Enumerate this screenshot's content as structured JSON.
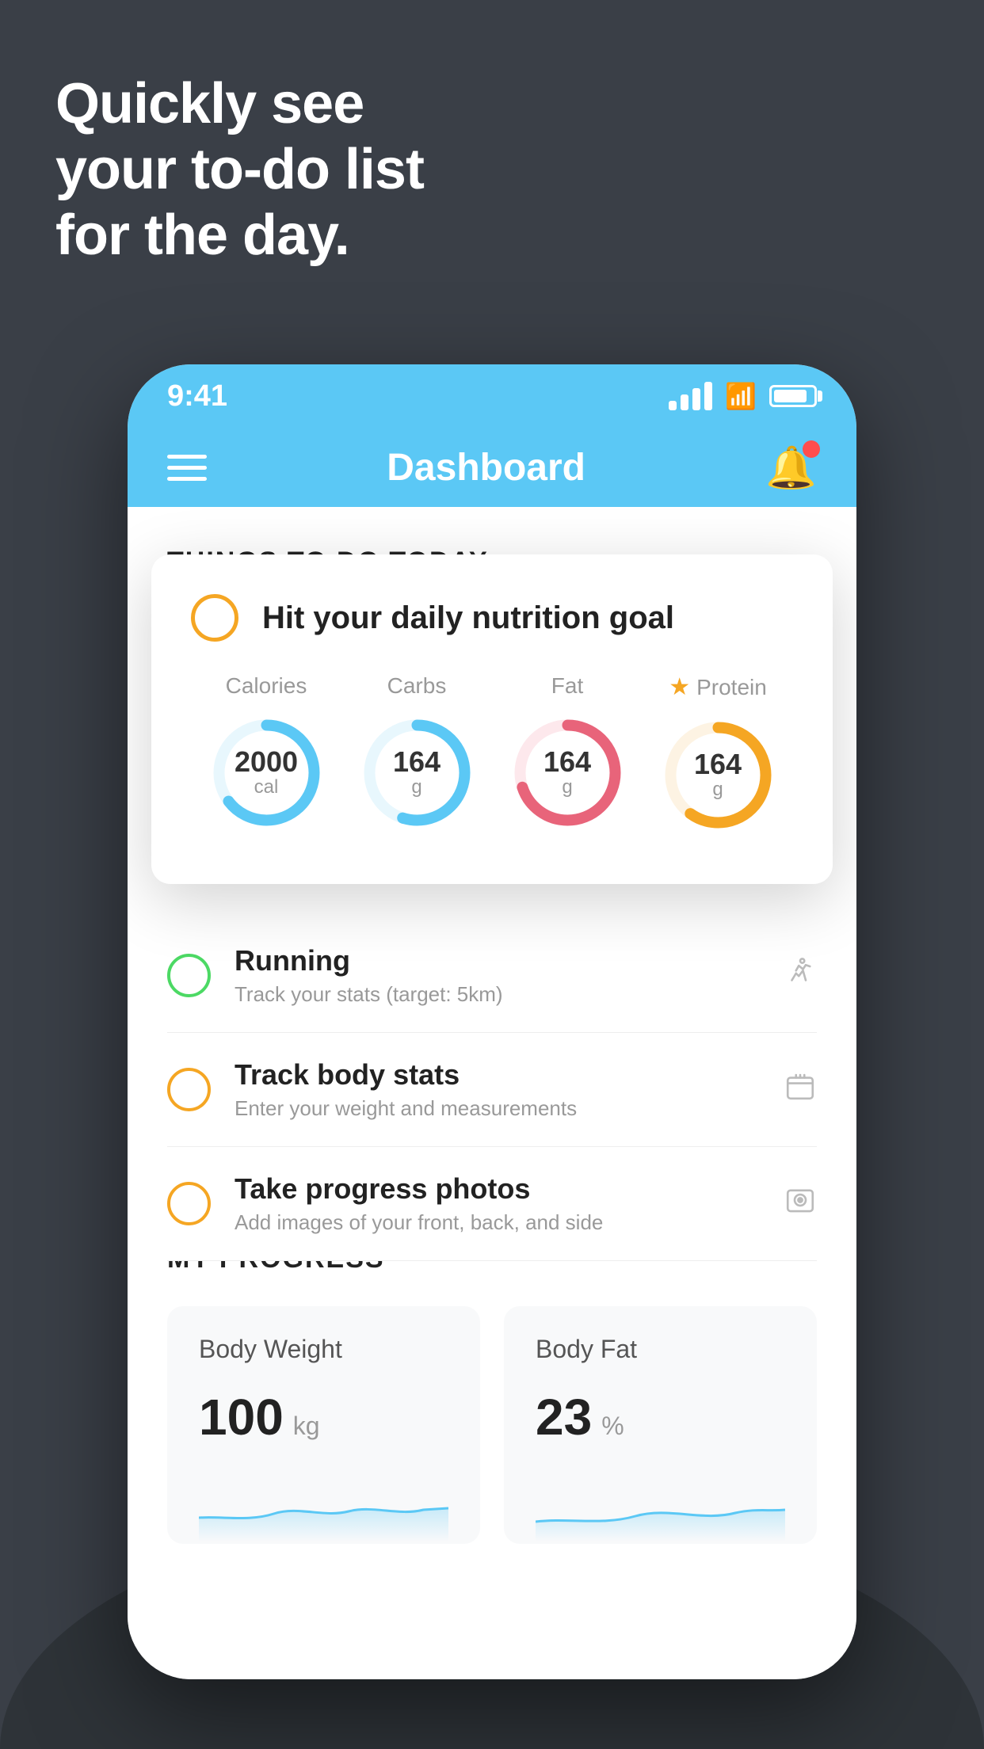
{
  "hero": {
    "line1": "Quickly see",
    "line2": "your to-do list",
    "line3": "for the day."
  },
  "phone": {
    "status_bar": {
      "time": "9:41"
    },
    "header": {
      "title": "Dashboard"
    },
    "section_title": "THINGS TO DO TODAY",
    "floating_card": {
      "circle_color": "yellow",
      "title": "Hit your daily nutrition goal",
      "nutrition": [
        {
          "label": "Calories",
          "value": "2000",
          "unit": "cal",
          "color": "#5bc8f5",
          "track_pct": 65,
          "star": false
        },
        {
          "label": "Carbs",
          "value": "164",
          "unit": "g",
          "color": "#5bc8f5",
          "track_pct": 55,
          "star": false
        },
        {
          "label": "Fat",
          "value": "164",
          "unit": "g",
          "color": "#e8647a",
          "track_pct": 70,
          "star": false
        },
        {
          "label": "Protein",
          "value": "164",
          "unit": "g",
          "color": "#f5a623",
          "track_pct": 60,
          "star": true
        }
      ]
    },
    "tasks": [
      {
        "circle_color": "green",
        "name": "Running",
        "desc": "Track your stats (target: 5km)",
        "icon": "👟"
      },
      {
        "circle_color": "yellow",
        "name": "Track body stats",
        "desc": "Enter your weight and measurements",
        "icon": "⚖️"
      },
      {
        "circle_color": "yellow",
        "name": "Take progress photos",
        "desc": "Add images of your front, back, and side",
        "icon": "🖼️"
      }
    ],
    "progress": {
      "section_title": "MY PROGRESS",
      "cards": [
        {
          "title": "Body Weight",
          "value": "100",
          "unit": "kg"
        },
        {
          "title": "Body Fat",
          "value": "23",
          "unit": "%"
        }
      ]
    }
  }
}
